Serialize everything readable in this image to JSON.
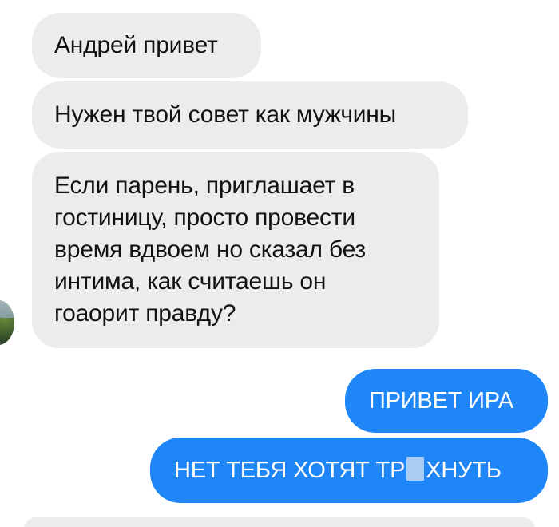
{
  "thread": {
    "incoming": [
      {
        "lines": [
          "Андрей привет"
        ]
      },
      {
        "lines": [
          "Нужен твой совет как мужчины"
        ]
      },
      {
        "lines": [
          "Если парень, приглашает в",
          "гостиницу, просто провести",
          "время вдвоем но сказал без",
          "интима, как считаешь он",
          "гоаорит правду?"
        ]
      }
    ],
    "outgoing": [
      {
        "text": "ПРИВЕТ ИРА"
      },
      {
        "text_before": "НЕТ ТЕБЯ ХОТЯТ ТР",
        "text_after": "ХНУТЬ",
        "censored": true
      }
    ]
  },
  "colors": {
    "incoming_bubble": "#ececed",
    "outgoing_bubble": "#1f86f7",
    "censor_block": "#a9ccf5"
  },
  "icons": {
    "avatar": "contact-avatar"
  }
}
